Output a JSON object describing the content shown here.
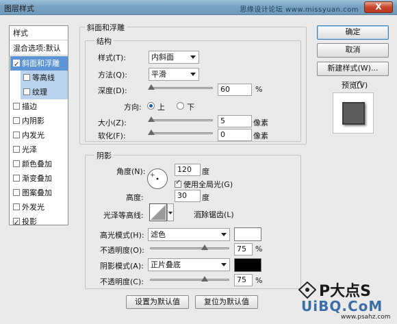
{
  "window": {
    "title": "图层样式",
    "watermark": "思缘设计论坛 www.missyuan.com",
    "close_label": "X"
  },
  "sidebar": {
    "header": "样式",
    "blend_item": "混合选项:默认",
    "items": [
      {
        "label": "斜面和浮雕",
        "checked": true
      },
      {
        "label": "等高线",
        "checked": false
      },
      {
        "label": "纹理",
        "checked": false
      },
      {
        "label": "描边",
        "checked": false
      },
      {
        "label": "内阴影",
        "checked": false
      },
      {
        "label": "内发光",
        "checked": false
      },
      {
        "label": "光泽",
        "checked": false
      },
      {
        "label": "颜色叠加",
        "checked": false
      },
      {
        "label": "渐变叠加",
        "checked": false
      },
      {
        "label": "图案叠加",
        "checked": false
      },
      {
        "label": "外发光",
        "checked": false
      },
      {
        "label": "投影",
        "checked": true
      }
    ]
  },
  "bevel": {
    "group_title": "斜面和浮雕",
    "structure_title": "结构",
    "style_label": "样式(T):",
    "style_value": "内斜面",
    "technique_label": "方法(Q):",
    "technique_value": "平滑",
    "depth_label": "深度(D):",
    "depth_value": "60",
    "depth_unit": "%",
    "depth_level": 0.0,
    "direction_label": "方向:",
    "dir_up": "上",
    "dir_down": "下",
    "direction_selected": "上",
    "size_label": "大小(Z):",
    "size_value": "5",
    "size_unit": "像素",
    "size_level": 0.0,
    "soften_label": "软化(F):",
    "soften_value": "0",
    "soften_unit": "像素",
    "soften_level": 0.0
  },
  "shading": {
    "title": "阴影",
    "angle_label": "角度(N):",
    "angle_value": "120",
    "angle_unit": "度",
    "global_light_label": "使用全局光(G)",
    "global_light_checked": true,
    "altitude_label": "高度:",
    "altitude_value": "30",
    "altitude_unit": "度",
    "gloss_label": "光泽等高线:",
    "antialias_label": "消除锯齿(L)",
    "antialias_checked": false,
    "highlight_label": "高光模式(H):",
    "highlight_mode": "滤色",
    "highlight_color": "#ffffff",
    "highlight_opacity_label": "不透明度(O):",
    "highlight_opacity": "75",
    "highlight_opacity_unit": "%",
    "highlight_opacity_level": 0.75,
    "shadow_label": "阴影模式(A):",
    "shadow_mode": "正片叠底",
    "shadow_color": "#000000",
    "shadow_opacity_label": "不透明度(C):",
    "shadow_opacity": "75",
    "shadow_opacity_unit": "%",
    "shadow_opacity_level": 0.75
  },
  "bottom_buttons": {
    "set_default": "设置为默认值",
    "reset_default": "复位为默认值"
  },
  "right": {
    "ok": "确定",
    "cancel": "取消",
    "new_style": "新建样式(W)...",
    "preview_label": "预览(V)",
    "preview_checked": true
  },
  "logo": {
    "text": "P大点S",
    "sub": "UiBQ.CoM",
    "url": "www.psahz.com"
  }
}
